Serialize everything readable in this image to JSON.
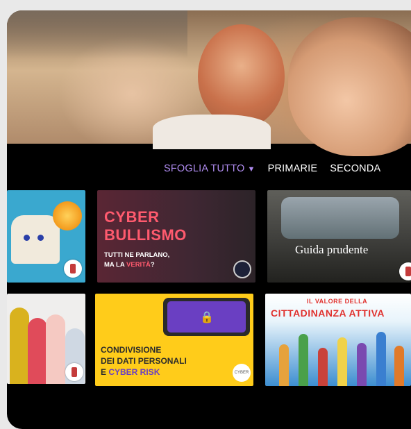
{
  "nav": {
    "items": [
      {
        "label": "SFOGLIA TUTTO",
        "active": true,
        "caret": "▼"
      },
      {
        "label": "PRIMARIE",
        "active": false
      },
      {
        "label": "SECONDA",
        "active": false
      }
    ]
  },
  "tiles": {
    "cyber_bullismo": {
      "line1": "CYBER",
      "line2": "BULLISMO",
      "line3": "TUTTI NE PARLANO,",
      "line4_prefix": "MA LA ",
      "line4_highlight": "VERITÀ",
      "line4_suffix": "?"
    },
    "guida_prudente": {
      "caption": "Guida prudente"
    },
    "condivisione": {
      "line1": "CONDIVISIONE",
      "line2": "DEI DATI PERSONALI",
      "line3_prefix": "E ",
      "line3_highlight": "CYBER RISK",
      "logo": "CYBER"
    },
    "cittadinanza": {
      "small": "IL VALORE DELLA",
      "big": "CITTADINANZA ATTIVA"
    }
  },
  "colors": {
    "accent": "#b08cf0",
    "background": "#000000",
    "cyber_red": "#ff5a6e",
    "cyber_purple": "#6a3fc2"
  }
}
